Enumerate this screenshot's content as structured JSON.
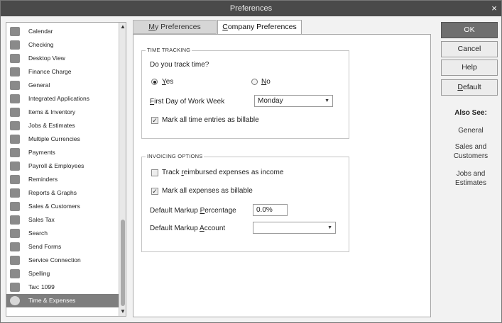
{
  "window": {
    "title": "Preferences",
    "close_glyph": "×"
  },
  "sidebar": {
    "items": [
      {
        "label": "Calendar",
        "icon": "calendar-icon"
      },
      {
        "label": "Checking",
        "icon": "checking-icon"
      },
      {
        "label": "Desktop View",
        "icon": "desktop-view-icon"
      },
      {
        "label": "Finance Charge",
        "icon": "finance-charge-icon"
      },
      {
        "label": "General",
        "icon": "general-icon"
      },
      {
        "label": "Integrated Applications",
        "icon": "integrated-apps-icon"
      },
      {
        "label": "Items & Inventory",
        "icon": "items-inventory-icon"
      },
      {
        "label": "Jobs & Estimates",
        "icon": "jobs-estimates-icon"
      },
      {
        "label": "Multiple Currencies",
        "icon": "currencies-icon"
      },
      {
        "label": "Payments",
        "icon": "payments-icon"
      },
      {
        "label": "Payroll & Employees",
        "icon": "payroll-icon"
      },
      {
        "label": "Reminders",
        "icon": "reminders-icon"
      },
      {
        "label": "Reports & Graphs",
        "icon": "reports-graphs-icon"
      },
      {
        "label": "Sales & Customers",
        "icon": "sales-customers-icon"
      },
      {
        "label": "Sales Tax",
        "icon": "sales-tax-icon"
      },
      {
        "label": "Search",
        "icon": "search-icon"
      },
      {
        "label": "Send Forms",
        "icon": "send-forms-icon"
      },
      {
        "label": "Service Connection",
        "icon": "service-connection-icon"
      },
      {
        "label": "Spelling",
        "icon": "spelling-icon"
      },
      {
        "label": "Tax: 1099",
        "icon": "tax-1099-icon"
      },
      {
        "label": "Time & Expenses",
        "icon": "time-expenses-icon",
        "selected": true
      }
    ],
    "scroll_up": "▲",
    "scroll_down": "▼"
  },
  "tabs": {
    "my_prefix": "M",
    "my_rest": "y Preferences",
    "company_prefix": "C",
    "company_rest": "ompany Preferences"
  },
  "time_tracking": {
    "title": "TIME TRACKING",
    "question": "Do you track time?",
    "yes_prefix": "Y",
    "yes_rest": "es",
    "no_prefix": "N",
    "no_rest": "o",
    "selected": "Yes",
    "first_day_prefix": "F",
    "first_day_rest": "irst Day of Work Week",
    "first_day_value": "Monday",
    "billable_label": "Mark all time entries as billable",
    "billable_checked": true
  },
  "invoicing": {
    "title": "INVOICING OPTIONS",
    "track_pre": "Track ",
    "track_key": "r",
    "track_rest": "eimbursed expenses as income",
    "track_checked": false,
    "mark_label": "Mark all expenses as billable",
    "mark_checked": true,
    "markup_pct_pre": "Default Markup ",
    "markup_pct_key": "P",
    "markup_pct_rest": "ercentage",
    "markup_pct_value": "0.0%",
    "markup_acct_pre": "Default Markup ",
    "markup_acct_key": "A",
    "markup_acct_rest": "ccount",
    "markup_acct_value": ""
  },
  "buttons": {
    "ok": "OK",
    "cancel": "Cancel",
    "help": "Help",
    "default_prefix": "D",
    "default_rest": "efault"
  },
  "also_see": {
    "heading": "Also See:",
    "links": [
      "General",
      "Sales and Customers",
      "Jobs and Estimates"
    ]
  },
  "glyphs": {
    "check": "✓",
    "dropdown": "▼"
  }
}
